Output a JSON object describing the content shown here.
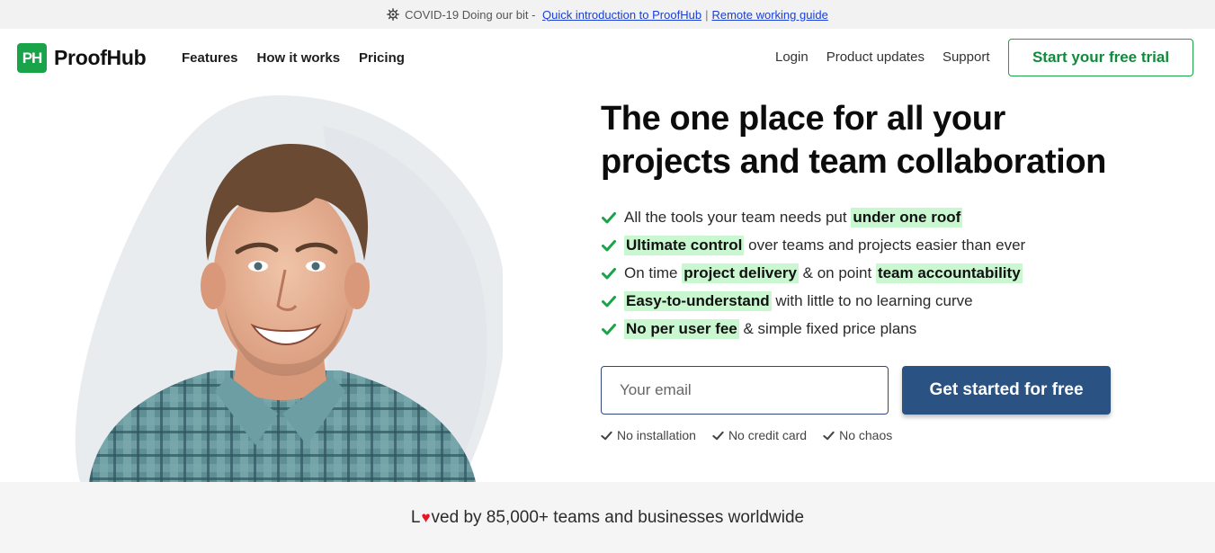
{
  "announcement": {
    "prefix": "COVID-19 Doing our bit - ",
    "link_intro": "Quick introduction to ProofHub",
    "separator": "|",
    "link_guide": "Remote working guide"
  },
  "header": {
    "logo_mark": "PH",
    "logo_text": "ProofHub",
    "nav": [
      "Features",
      "How it works",
      "Pricing"
    ],
    "right_nav": [
      "Login",
      "Product updates",
      "Support"
    ],
    "trial_button": "Start your free trial"
  },
  "hero": {
    "headline_line1": "The one place for all your",
    "headline_line2": "projects and team collaboration",
    "features": [
      {
        "parts": [
          {
            "t": "All the tools your team needs put ",
            "h": false
          },
          {
            "t": "under one roof",
            "h": true
          }
        ]
      },
      {
        "parts": [
          {
            "t": "Ultimate control",
            "h": true
          },
          {
            "t": " over teams and projects easier than ever",
            "h": false
          }
        ]
      },
      {
        "parts": [
          {
            "t": "On time ",
            "h": false
          },
          {
            "t": "project delivery",
            "h": true
          },
          {
            "t": " & on point ",
            "h": false
          },
          {
            "t": "team accountability",
            "h": true
          }
        ]
      },
      {
        "parts": [
          {
            "t": "Easy-to-understand",
            "h": true
          },
          {
            "t": " with little to no learning curve",
            "h": false
          }
        ]
      },
      {
        "parts": [
          {
            "t": "No per user fee",
            "h": true
          },
          {
            "t": " & simple fixed price plans",
            "h": false
          }
        ]
      }
    ],
    "email_placeholder": "Your email",
    "email_value": "",
    "cta_button": "Get started for free",
    "perks": [
      "No installation",
      "No credit card",
      "No chaos"
    ]
  },
  "social_proof": {
    "prefix": "L",
    "suffix": "ved by 85,000+ teams and businesses worldwide"
  },
  "colors": {
    "brand_green": "#19a44a",
    "highlight": "#c8f7d0",
    "cta_blue": "#2a5283",
    "link_blue": "#1a3fd6",
    "heart_red": "#e0192a"
  },
  "icons": {
    "announcement": "gear-icon",
    "feature_bullet": "check-icon",
    "perk_bullet": "small-check-icon",
    "love": "heart-icon"
  }
}
